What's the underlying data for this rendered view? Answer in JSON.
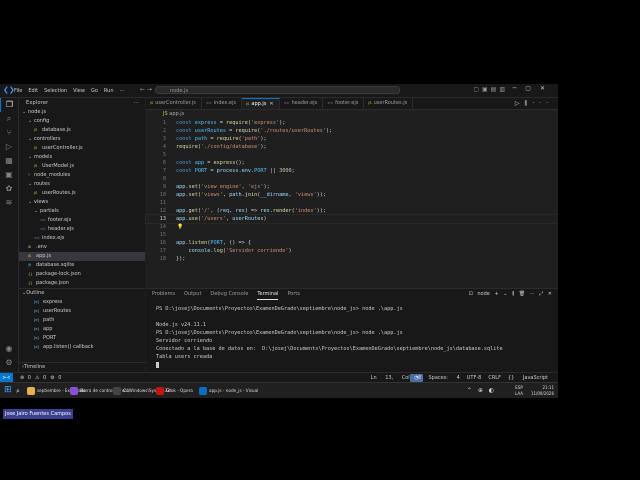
{
  "titlebar": {
    "menu": [
      "File",
      "Edit",
      "Selection",
      "View",
      "Go",
      "Run"
    ],
    "more": "···",
    "search": "node.js"
  },
  "sidebar": {
    "title": "Explorer",
    "more": "···",
    "root": "node.js",
    "items": [
      {
        "label": "config",
        "kind": "folder",
        "open": true,
        "depth": 1
      },
      {
        "label": "database.js",
        "kind": "js",
        "depth": 2
      },
      {
        "label": "controllers",
        "kind": "folder",
        "open": true,
        "depth": 1
      },
      {
        "label": "userController.js",
        "kind": "js",
        "depth": 2
      },
      {
        "label": "models",
        "kind": "folder",
        "open": true,
        "depth": 1
      },
      {
        "label": "UserModel.js",
        "kind": "js",
        "depth": 2
      },
      {
        "label": "node_modules",
        "kind": "folder",
        "open": false,
        "depth": 1
      },
      {
        "label": "routes",
        "kind": "folder",
        "open": true,
        "depth": 1
      },
      {
        "label": "userRoutes.js",
        "kind": "js",
        "depth": 2
      },
      {
        "label": "views",
        "kind": "folder",
        "open": true,
        "depth": 1
      },
      {
        "label": "partials",
        "kind": "folder",
        "open": true,
        "depth": 2
      },
      {
        "label": "footer.ejs",
        "kind": "ejs",
        "depth": 3
      },
      {
        "label": "header.ejs",
        "kind": "ejs",
        "depth": 3
      },
      {
        "label": "index.ejs",
        "kind": "ejs",
        "depth": 2
      },
      {
        "label": ".env",
        "kind": "env",
        "depth": 1
      },
      {
        "label": "app.js",
        "kind": "js",
        "depth": 1,
        "selected": true
      },
      {
        "label": "database.sqlite",
        "kind": "db",
        "depth": 1
      },
      {
        "label": "package-lock.json",
        "kind": "json",
        "depth": 1
      },
      {
        "label": "package.json",
        "kind": "json",
        "depth": 1
      }
    ],
    "outline_title": "Outline",
    "outline": [
      "express",
      "userRoutes",
      "path",
      "app",
      "PORT",
      "app.listen() callback"
    ],
    "timeline_title": "Timeline"
  },
  "tabs": [
    {
      "label": "userController.js",
      "kind": "js",
      "active": false
    },
    {
      "label": "index.ejs",
      "kind": "ejs",
      "active": false
    },
    {
      "label": "app.js",
      "kind": "js",
      "active": true
    },
    {
      "label": "header.ejs",
      "kind": "ejs",
      "active": false
    },
    {
      "label": "footer.ejs",
      "kind": "ejs",
      "active": false
    },
    {
      "label": "userRoutes.js",
      "kind": "js",
      "active": false
    }
  ],
  "breadcrumb": "app.js",
  "code": [
    [
      [
        "kw",
        "const "
      ],
      [
        "cst",
        "express"
      ],
      [
        "pl",
        " = "
      ],
      [
        "fn",
        "require"
      ],
      [
        "pl",
        "("
      ],
      [
        "str",
        "'express'"
      ],
      [
        "pl",
        ");"
      ]
    ],
    [
      [
        "kw",
        "const "
      ],
      [
        "cst",
        "userRoutes"
      ],
      [
        "pl",
        " = "
      ],
      [
        "fn",
        "require"
      ],
      [
        "pl",
        "("
      ],
      [
        "str",
        "'./routes/userRoutes'"
      ],
      [
        "pl",
        ");"
      ]
    ],
    [
      [
        "kw",
        "const "
      ],
      [
        "cst",
        "path"
      ],
      [
        "pl",
        " = "
      ],
      [
        "fn",
        "require"
      ],
      [
        "pl",
        "("
      ],
      [
        "str",
        "'path'"
      ],
      [
        "pl",
        ");"
      ]
    ],
    [
      [
        "fn",
        "require"
      ],
      [
        "pl",
        "("
      ],
      [
        "str",
        "'./config/database'"
      ],
      [
        "pl",
        ");"
      ]
    ],
    [],
    [
      [
        "kw",
        "const "
      ],
      [
        "cst",
        "app"
      ],
      [
        "pl",
        " = "
      ],
      [
        "fn",
        "express"
      ],
      [
        "pl",
        "();"
      ]
    ],
    [
      [
        "kw",
        "const "
      ],
      [
        "cst",
        "PORT"
      ],
      [
        "pl",
        " = "
      ],
      [
        "id",
        "process"
      ],
      [
        "pl",
        "."
      ],
      [
        "id",
        "env"
      ],
      [
        "pl",
        "."
      ],
      [
        "cst",
        "PORT"
      ],
      [
        "pl",
        " || "
      ],
      [
        "num",
        "3000"
      ],
      [
        "pl",
        ";"
      ]
    ],
    [],
    [
      [
        "id",
        "app"
      ],
      [
        "pl",
        "."
      ],
      [
        "fn",
        "set"
      ],
      [
        "pl",
        "("
      ],
      [
        "str",
        "'view engine'"
      ],
      [
        "pl",
        ", "
      ],
      [
        "str",
        "'ejs'"
      ],
      [
        "pl",
        ");"
      ]
    ],
    [
      [
        "id",
        "app"
      ],
      [
        "pl",
        "."
      ],
      [
        "fn",
        "set"
      ],
      [
        "pl",
        "("
      ],
      [
        "str",
        "'views'"
      ],
      [
        "pl",
        ", "
      ],
      [
        "id",
        "path"
      ],
      [
        "pl",
        "."
      ],
      [
        "fn",
        "join"
      ],
      [
        "pl",
        "("
      ],
      [
        "id",
        "__dirname"
      ],
      [
        "pl",
        ", "
      ],
      [
        "str",
        "'views'"
      ],
      [
        "pl",
        "));"
      ]
    ],
    [],
    [
      [
        "id",
        "app"
      ],
      [
        "pl",
        "."
      ],
      [
        "fn",
        "get"
      ],
      [
        "pl",
        "("
      ],
      [
        "str",
        "'/'"
      ],
      [
        "pl",
        ", ("
      ],
      [
        "id",
        "req"
      ],
      [
        "pl",
        ", "
      ],
      [
        "id",
        "res"
      ],
      [
        "pl",
        ") => "
      ],
      [
        "id",
        "res"
      ],
      [
        "pl",
        "."
      ],
      [
        "fn",
        "render"
      ],
      [
        "pl",
        "("
      ],
      [
        "str",
        "'index'"
      ],
      [
        "pl",
        "));"
      ]
    ],
    [
      [
        "id",
        "app"
      ],
      [
        "pl",
        "."
      ],
      [
        "fn",
        "use"
      ],
      [
        "pl",
        "("
      ],
      [
        "str",
        "'/users'"
      ],
      [
        "pl",
        ", "
      ],
      [
        "id",
        "userRoutes"
      ],
      [
        "pl",
        ")"
      ]
    ],
    [],
    [],
    [
      [
        "id",
        "app"
      ],
      [
        "pl",
        "."
      ],
      [
        "fn",
        "listen"
      ],
      [
        "pl",
        "("
      ],
      [
        "cst",
        "PORT"
      ],
      [
        "pl",
        ", () => {"
      ]
    ],
    [
      [
        "pl",
        "    "
      ],
      [
        "id",
        "console"
      ],
      [
        "pl",
        "."
      ],
      [
        "fn",
        "log"
      ],
      [
        "pl",
        "("
      ],
      [
        "str",
        "'Servidor corriendo'"
      ],
      [
        "pl",
        ")"
      ]
    ],
    [
      [
        "pl",
        "});"
      ]
    ]
  ],
  "current_line": 13,
  "panel": {
    "tabs": [
      "Problems",
      "Output",
      "Debug Console",
      "Terminal",
      "Ports"
    ],
    "active": "Terminal",
    "terminal_name": "node",
    "lines": [
      "PS D:\\josej\\Documents\\Proyectos\\ExamenDeGrado\\septiembre\\node_js> node .\\app.js",
      "",
      "Node.js v24.11.1",
      "PS D:\\josej\\Documents\\Proyectos\\ExamenDeGrado\\septiembre\\node_js> node .\\app.js",
      "Servidor corriendo",
      "Conectado a la base de datos en:  D:\\josej\\Documents\\Proyectos\\ExamenDeGrado\\septiembre\\node_js\\database.sqlite",
      "Tabla users creada"
    ]
  },
  "status": {
    "items_left": [
      "⊗ 0",
      "⚠ 0",
      "⚙ 0"
    ],
    "items_right": [
      "Ln 13, Col 8",
      "Spaces: 4",
      "UTF-8",
      "CRLF",
      "{} JavaScript"
    ]
  },
  "taskbar": {
    "items": [
      {
        "label": "septiembre - Explorado",
        "color": "#e8b24a"
      },
      {
        "label": "Barra de control de voz",
        "color": "#8a4fd8"
      },
      {
        "label": "C:\\Windows\\System32\\",
        "color": "#444"
      },
      {
        "label": "Grok - Opera",
        "color": "#c11"
      },
      {
        "label": "app.js - node_js - Visual",
        "color": "#0a6fc2"
      }
    ],
    "lang_top": "ESP",
    "lang_bottom": "LAA",
    "time": "21:11",
    "date": "11/09/2026"
  },
  "name_tag": "Jose Jairo Fuentes Campos"
}
